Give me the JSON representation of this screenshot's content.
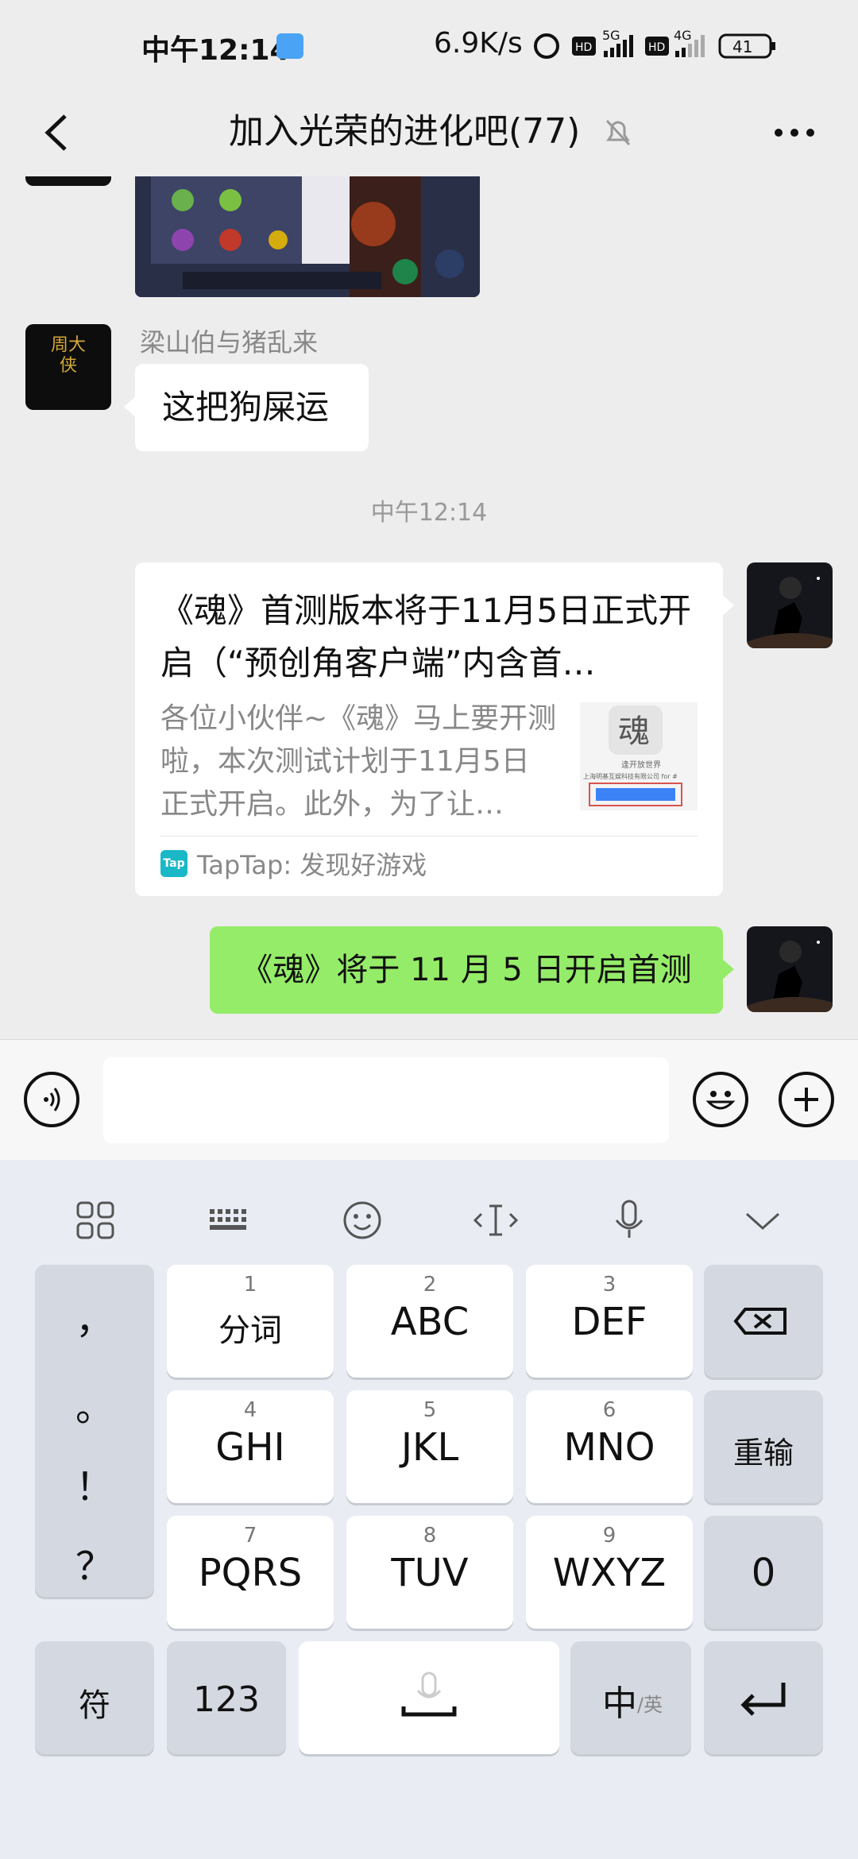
{
  "status_bar": {
    "time": "中午12:14",
    "net_speed": "6.9K/s",
    "sim1": "5G",
    "sim2": "4G",
    "hd1": "HD",
    "hd2": "HD",
    "battery": "41"
  },
  "header": {
    "title": "加入光荣的进化吧(77)",
    "back_icon": "chevron-left-icon",
    "mute_icon": "bell-off-icon",
    "more_icon": "more-dots-icon"
  },
  "messages": {
    "sender_name": "梁山伯与猪乱来",
    "text1": "这把狗屎运",
    "timestamp": "中午12:14",
    "card": {
      "title": "《魂》首测版本将于11月5日正式开启（“预创角客户端”内含首…",
      "description": "各位小伙伴~《魂》马上要开测啦，本次测试计划于11月5日正式开启。此外，为了让…",
      "source": "TapTap: 发现好游戏",
      "source_icon_text": "Tap",
      "thumb_caption1": "逢开放世界",
      "thumb_caption2": "上海明基互娱科技有限公司 for #"
    },
    "text2": "《魂》将于 11 月 5 日开启首测",
    "avatar_left_text": "周大侠"
  },
  "input_bar": {
    "voice_icon": "voice-icon",
    "emoji_icon": "emoji-icon",
    "plus_icon": "plus-icon"
  },
  "keyboard": {
    "toolbar": [
      "grid-icon",
      "keyboard-icon",
      "smiley-icon",
      "cursor-icon",
      "mic-icon",
      "collapse-icon"
    ],
    "punct": [
      "，",
      "。",
      "！",
      "？"
    ],
    "keys": [
      {
        "num": "1",
        "label": "分词"
      },
      {
        "num": "2",
        "label": "ABC"
      },
      {
        "num": "3",
        "label": "DEF"
      },
      {
        "num": "4",
        "label": "GHI"
      },
      {
        "num": "5",
        "label": "JKL"
      },
      {
        "num": "6",
        "label": "MNO"
      },
      {
        "num": "7",
        "label": "PQRS"
      },
      {
        "num": "8",
        "label": "TUV"
      },
      {
        "num": "9",
        "label": "WXYZ"
      }
    ],
    "delete": "backspace-icon",
    "reenter": "重输",
    "zero": "0",
    "symbol": "符",
    "numbers": "123",
    "lang_main": "中",
    "lang_sub": "/英",
    "enter": "enter-icon"
  }
}
